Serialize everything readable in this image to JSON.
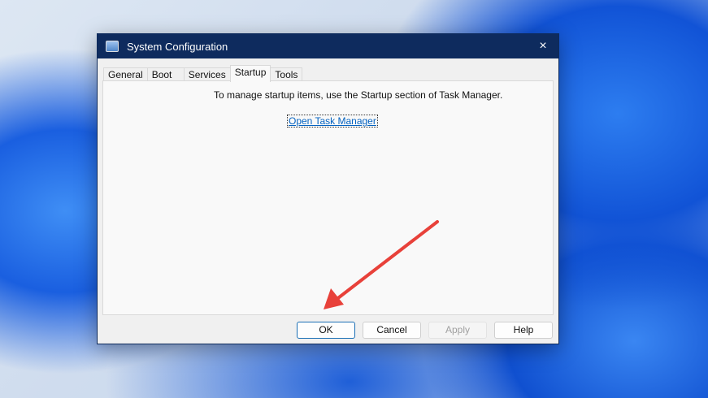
{
  "window": {
    "title": "System Configuration",
    "close_icon": "×"
  },
  "tabs": [
    {
      "label": "General"
    },
    {
      "label": "Boot"
    },
    {
      "label": "Services"
    },
    {
      "label": "Startup",
      "active": true
    },
    {
      "label": "Tools"
    }
  ],
  "startup": {
    "message": "To manage startup items, use the Startup section of Task Manager.",
    "link": "Open Task Manager"
  },
  "buttons": {
    "ok": "OK",
    "cancel": "Cancel",
    "apply": "Apply",
    "help": "Help"
  },
  "annotation": {
    "arrow_color": "#e8413a"
  }
}
